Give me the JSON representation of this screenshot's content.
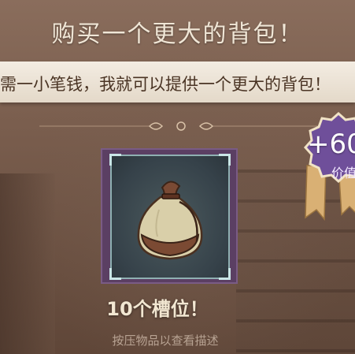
{
  "title": "购买一个更大的背包！",
  "banner": {
    "text": "需一小笔钱，我就可以提供一个更大的背包！"
  },
  "item": {
    "icon": "drawstring-bag-icon",
    "slots_label": "10个槽位！",
    "hint": "按压物品以查看描述"
  },
  "badge": {
    "value": "+60",
    "caption": "价值"
  },
  "colors": {
    "card_frame": "#5b3f63",
    "badge": "#6f4f9a",
    "banner": "#f3ece2"
  }
}
